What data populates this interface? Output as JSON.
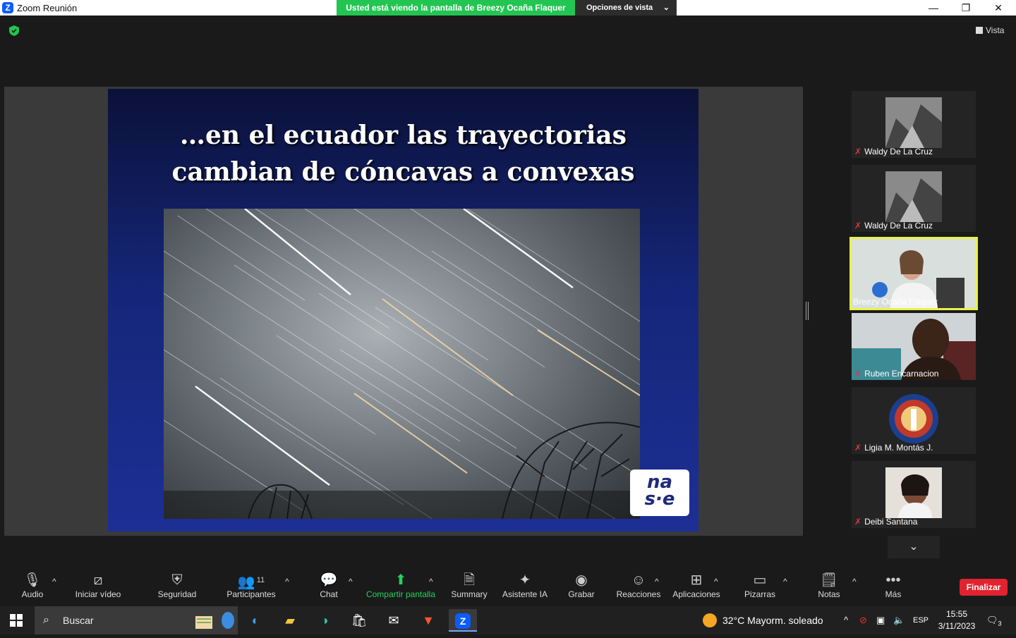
{
  "window": {
    "title": "Zoom Reunión",
    "app_icon": "Z"
  },
  "banner": {
    "viewing": "Usted está viendo la pantalla de Breezy Ocaña Flaquer",
    "view_options": "Opciones de vista"
  },
  "window_controls": {
    "minimize": "—",
    "maximize": "❐",
    "close": "✕"
  },
  "top_right": {
    "view_label": "Vista"
  },
  "slide": {
    "title": "…en el ecuador las trayectorias cambian de cóncavas a convexas",
    "logo_text_top": "na",
    "logo_text_bottom": "s·e"
  },
  "participants": [
    {
      "name": "Waldy De La Cruz",
      "muted": true,
      "active": false
    },
    {
      "name": "Waldy De La Cruz",
      "muted": true,
      "active": false
    },
    {
      "name": "Breezy Ocaña Flaquer",
      "muted": false,
      "active": true
    },
    {
      "name": "Ruben Encarnacion",
      "muted": true,
      "active": false
    },
    {
      "name": "Ligia  M. Montás J.",
      "muted": true,
      "active": false
    },
    {
      "name": "Deibi Santana",
      "muted": true,
      "active": false
    }
  ],
  "toolbar": {
    "audio": "Audio",
    "video": "Iniciar vídeo",
    "security": "Seguridad",
    "participants": "Participantes",
    "participants_count": "11",
    "chat": "Chat",
    "share": "Compartir pantalla",
    "summary": "Summary",
    "ai": "Asistente IA",
    "record": "Grabar",
    "reactions": "Reacciones",
    "apps": "Aplicaciones",
    "whiteboards": "Pizarras",
    "notes": "Notas",
    "more": "Más",
    "end": "Finalizar"
  },
  "taskbar": {
    "search_label": "Buscar",
    "weather": "32°C  Mayorm. soleado",
    "language": "ESP",
    "time": "15:55",
    "date": "3/11/2023",
    "notification_count": "3"
  },
  "colors": {
    "share_green": "#23c552",
    "end_red": "#e0232f",
    "active_speaker": "#e8f24a",
    "zoom_blue": "#0b5cff"
  }
}
